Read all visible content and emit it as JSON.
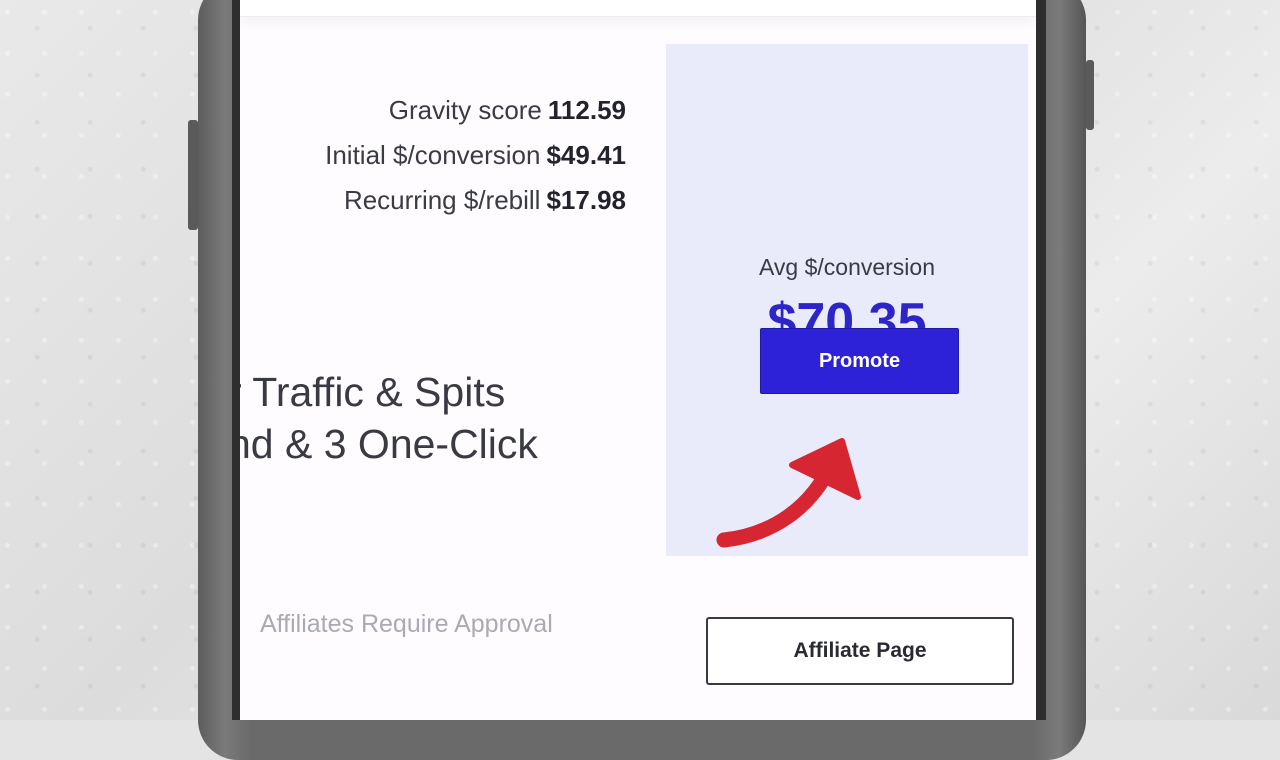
{
  "listing": {
    "stats": [
      {
        "label": "Gravity score",
        "value": "112.59"
      },
      {
        "label": "Initial $/conversion",
        "value": "$49.41"
      },
      {
        "label": "Recurring $/rebill",
        "value": "$17.98"
      }
    ],
    "description_lines": [
      "r Traffic & Spits",
      "nd & 3 One-Click"
    ],
    "approval_note": "Affiliates Require Approval"
  },
  "promo_panel": {
    "avg_label": "Avg $/conversion",
    "avg_value": "$70.35",
    "promote_label": "Promote",
    "accent_color": "#2d22d8",
    "panel_bg": "#e9eafa"
  },
  "affiliate_page_label": "Affiliate Page",
  "annotation": {
    "icon": "red-arrow-icon",
    "color": "#d62631"
  }
}
